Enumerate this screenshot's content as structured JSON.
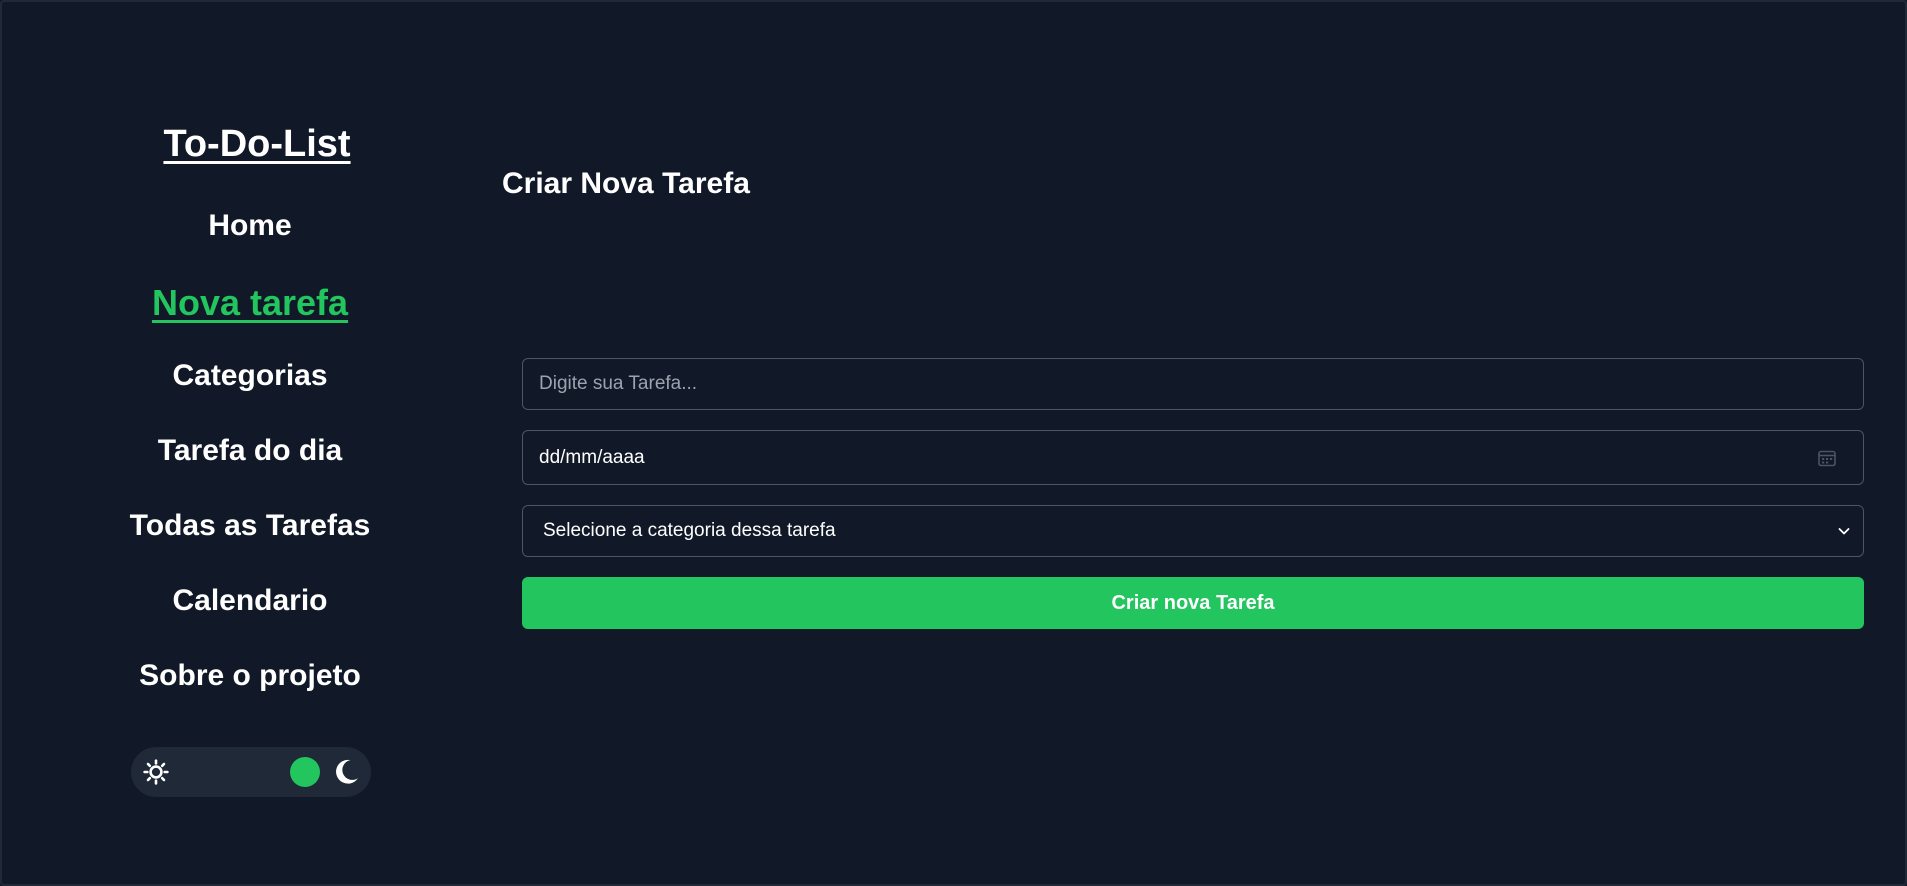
{
  "sidebar": {
    "brand": "To-Do-List",
    "nav": [
      {
        "label": "Home",
        "active": false
      },
      {
        "label": "Nova tarefa",
        "active": true
      },
      {
        "label": "Categorias",
        "active": false
      },
      {
        "label": "Tarefa do dia",
        "active": false
      },
      {
        "label": "Todas as Tarefas",
        "active": false
      },
      {
        "label": "Calendario",
        "active": false
      },
      {
        "label": "Sobre o projeto",
        "active": false
      }
    ],
    "theme_toggle": {
      "mode": "dark",
      "left_icon": "sun-icon",
      "right_icon": "moon-icon",
      "accent": "#22c55e"
    }
  },
  "main": {
    "title": "Criar Nova Tarefa",
    "form": {
      "task_placeholder": "Digite sua Tarefa...",
      "task_value": "",
      "date_value": "dd/mm/aaaa",
      "category_selected": "Selecione a categoria dessa tarefa",
      "submit_label": "Criar nova Tarefa"
    }
  },
  "colors": {
    "background": "#111827",
    "panel": "#1f2937",
    "accent": "#22c55e",
    "border": "#4b5563"
  }
}
